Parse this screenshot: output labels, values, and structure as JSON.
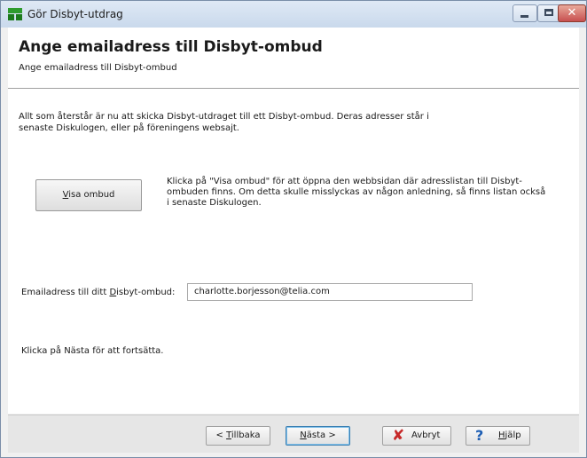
{
  "window": {
    "title": "Gör Disbyt-utdrag"
  },
  "header": {
    "title": "Ange emailadress till Disbyt-ombud",
    "subtitle": "Ange emailadress till Disbyt-ombud"
  },
  "main": {
    "intro_text": "Allt som återstår är nu att skicka Disbyt-utdraget till ett Disbyt-ombud. Deras adresser står i senaste Diskulogen, eller på föreningens websajt.",
    "visa_button": {
      "mnemonic": "V",
      "rest": "isa ombud"
    },
    "description": "Klicka på \"Visa ombud\" för att öppna den webbsidan där adresslistan till Disbyt-ombuden finns. Om detta skulle misslyckas av någon anledning, så finns listan också i senaste Diskulogen.",
    "email_label": {
      "before": "Emailadress till ditt ",
      "mnemonic": "D",
      "after": "isbyt-ombud:"
    },
    "email_value": "charlotte.borjesson@telia.com",
    "hint_text": "Klicka på Nästa för att fortsätta."
  },
  "footer": {
    "back": {
      "before": "< ",
      "mnemonic": "T",
      "after": "illbaka"
    },
    "next": {
      "mnemonic": "N",
      "after": "ästa >"
    },
    "cancel": {
      "label": "Avbryt",
      "icon": "cancel-icon"
    },
    "help": {
      "mnemonic": "H",
      "after": "jälp",
      "icon": "help-icon"
    }
  },
  "colors": {
    "titlebar": "#c9d9ec",
    "close_button": "#c75050",
    "cancel_icon": "#c62828",
    "help_icon": "#1f5fb4"
  }
}
